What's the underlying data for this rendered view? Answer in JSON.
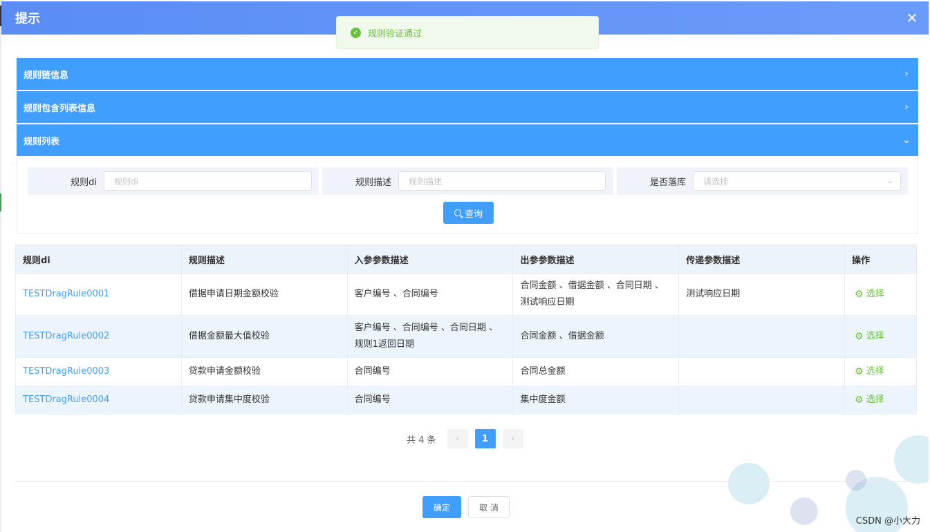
{
  "dialog": {
    "title": "提示",
    "close_icon": "close-icon"
  },
  "toast": {
    "message": "规则验证通过",
    "icon": "check-circle-icon",
    "color": "#67c23a"
  },
  "collapse": [
    {
      "label": "规则链信息",
      "state": "collapsed"
    },
    {
      "label": "规则包含列表信息",
      "state": "collapsed"
    },
    {
      "label": "规则列表",
      "state": "expanded"
    }
  ],
  "search": {
    "fields": [
      {
        "label": "规则di",
        "placeholder": "规则di"
      },
      {
        "label": "规则描述",
        "placeholder": "规则描述"
      },
      {
        "label": "是否落库",
        "placeholder": "请选择"
      }
    ],
    "query_label": "查询"
  },
  "table": {
    "headers": [
      "规则di",
      "规则描述",
      "入参参数描述",
      "出参参数描述",
      "传递参数描述",
      "操作"
    ],
    "rows": [
      {
        "id": "TESTDragRule0001",
        "desc": "借据申请日期金额校验",
        "in": "客户编号 、合同编号",
        "out": "合同金额 、借据金额 、合同日期 、测试响应日期",
        "pass": "测试响应日期",
        "action": "选择"
      },
      {
        "id": "TESTDragRule0002",
        "desc": "借据金额最大值校验",
        "in": "客户编号 、合同编号 、合同日期 、规则1返回日期",
        "out": "合同金额 、借据金额",
        "pass": "",
        "action": "选择"
      },
      {
        "id": "TESTDragRule0003",
        "desc": "贷款申请金额校验",
        "in": "合同编号",
        "out": "合同总金额",
        "pass": "",
        "action": "选择"
      },
      {
        "id": "TESTDragRule0004",
        "desc": "贷款申请集中度校验",
        "in": "合同编号",
        "out": "集中度金额",
        "pass": "",
        "action": "选择"
      }
    ]
  },
  "pagination": {
    "total_text": "共 4 条",
    "current_page": "1"
  },
  "footer": {
    "ok_label": "确定",
    "cancel_label": "取 消"
  },
  "watermark": "CSDN @小大力",
  "colors": {
    "primary": "#409eff",
    "success": "#67c23a",
    "header": "#5b8ff9"
  }
}
